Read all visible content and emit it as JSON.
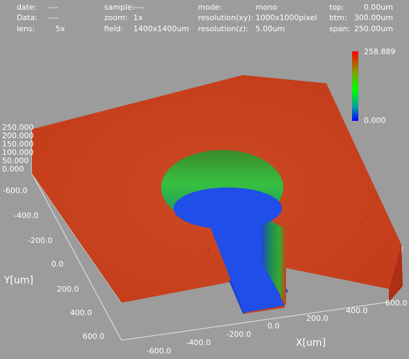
{
  "header": {
    "date_label": "date:",
    "date_value": "----",
    "data_label": "Data:",
    "data_value": "----",
    "lens_label": "lens:",
    "lens_value": "5x",
    "sample_label": "sample:",
    "sample_value": "----",
    "zoom_label": "zoom:",
    "zoom_value": "1x",
    "field_label": "field:",
    "field_value": "1400x1400um",
    "mode_label": "mode:",
    "mode_value": "mono",
    "resxy_label": "resolution(xy):",
    "resxy_value": "1000x1000pixel",
    "resz_label": "resolution(z):",
    "resz_value": "5.00um",
    "top_label": "top:",
    "top_value": "0.00um",
    "btm_label": "btm:",
    "btm_value": "300.00um",
    "span_label": "span:",
    "span_value": "250.00um"
  },
  "colorbar": {
    "max_label": "258.889",
    "min_label": "0.000",
    "colors": [
      "#ff0000",
      "#7fa000",
      "#00ff00",
      "#0000ff"
    ]
  },
  "axes": {
    "z_ticks": [
      "250.000",
      "200.000",
      "150.000",
      "100.000",
      "50.000",
      "0.000"
    ],
    "y_ticks": [
      "-600.0",
      "-400.0",
      "-200.0",
      "0.0",
      "200.0",
      "400.0",
      "600.0"
    ],
    "x_ticks": [
      "-600.0",
      "-400.0",
      "-200.0",
      "0.0",
      "200.0",
      "400.0",
      "600.0"
    ],
    "y_title": "Y[um]",
    "x_title": "X[um]"
  },
  "surface": {
    "top_color": "#c8401e",
    "mid_color": "#2aa22a",
    "bottom_color": "#1a3fd8"
  }
}
